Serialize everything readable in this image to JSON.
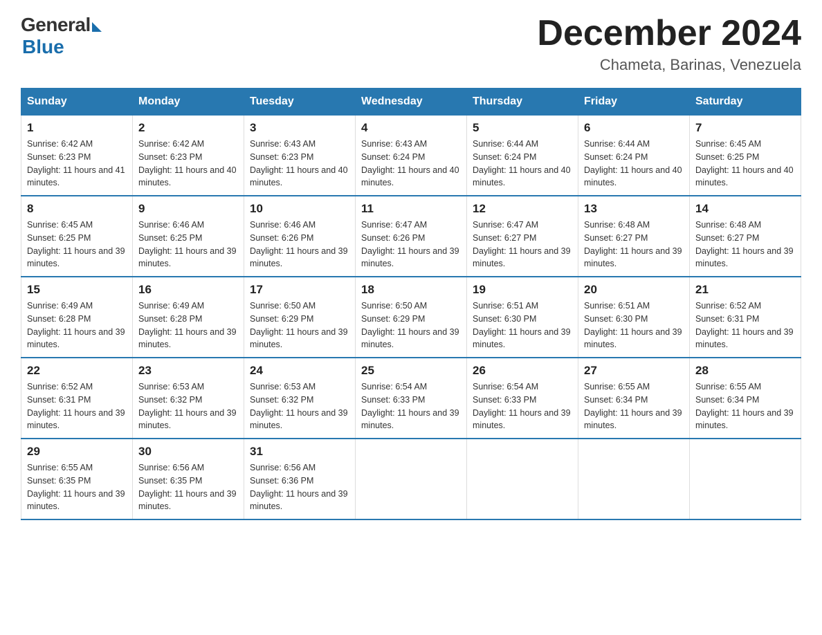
{
  "header": {
    "logo_general": "General",
    "logo_blue": "Blue",
    "month_title": "December 2024",
    "location": "Chameta, Barinas, Venezuela"
  },
  "days_of_week": [
    "Sunday",
    "Monday",
    "Tuesday",
    "Wednesday",
    "Thursday",
    "Friday",
    "Saturday"
  ],
  "weeks": [
    [
      {
        "day": "1",
        "sunrise": "6:42 AM",
        "sunset": "6:23 PM",
        "daylight": "11 hours and 41 minutes."
      },
      {
        "day": "2",
        "sunrise": "6:42 AM",
        "sunset": "6:23 PM",
        "daylight": "11 hours and 40 minutes."
      },
      {
        "day": "3",
        "sunrise": "6:43 AM",
        "sunset": "6:23 PM",
        "daylight": "11 hours and 40 minutes."
      },
      {
        "day": "4",
        "sunrise": "6:43 AM",
        "sunset": "6:24 PM",
        "daylight": "11 hours and 40 minutes."
      },
      {
        "day": "5",
        "sunrise": "6:44 AM",
        "sunset": "6:24 PM",
        "daylight": "11 hours and 40 minutes."
      },
      {
        "day": "6",
        "sunrise": "6:44 AM",
        "sunset": "6:24 PM",
        "daylight": "11 hours and 40 minutes."
      },
      {
        "day": "7",
        "sunrise": "6:45 AM",
        "sunset": "6:25 PM",
        "daylight": "11 hours and 40 minutes."
      }
    ],
    [
      {
        "day": "8",
        "sunrise": "6:45 AM",
        "sunset": "6:25 PM",
        "daylight": "11 hours and 39 minutes."
      },
      {
        "day": "9",
        "sunrise": "6:46 AM",
        "sunset": "6:25 PM",
        "daylight": "11 hours and 39 minutes."
      },
      {
        "day": "10",
        "sunrise": "6:46 AM",
        "sunset": "6:26 PM",
        "daylight": "11 hours and 39 minutes."
      },
      {
        "day": "11",
        "sunrise": "6:47 AM",
        "sunset": "6:26 PM",
        "daylight": "11 hours and 39 minutes."
      },
      {
        "day": "12",
        "sunrise": "6:47 AM",
        "sunset": "6:27 PM",
        "daylight": "11 hours and 39 minutes."
      },
      {
        "day": "13",
        "sunrise": "6:48 AM",
        "sunset": "6:27 PM",
        "daylight": "11 hours and 39 minutes."
      },
      {
        "day": "14",
        "sunrise": "6:48 AM",
        "sunset": "6:27 PM",
        "daylight": "11 hours and 39 minutes."
      }
    ],
    [
      {
        "day": "15",
        "sunrise": "6:49 AM",
        "sunset": "6:28 PM",
        "daylight": "11 hours and 39 minutes."
      },
      {
        "day": "16",
        "sunrise": "6:49 AM",
        "sunset": "6:28 PM",
        "daylight": "11 hours and 39 minutes."
      },
      {
        "day": "17",
        "sunrise": "6:50 AM",
        "sunset": "6:29 PM",
        "daylight": "11 hours and 39 minutes."
      },
      {
        "day": "18",
        "sunrise": "6:50 AM",
        "sunset": "6:29 PM",
        "daylight": "11 hours and 39 minutes."
      },
      {
        "day": "19",
        "sunrise": "6:51 AM",
        "sunset": "6:30 PM",
        "daylight": "11 hours and 39 minutes."
      },
      {
        "day": "20",
        "sunrise": "6:51 AM",
        "sunset": "6:30 PM",
        "daylight": "11 hours and 39 minutes."
      },
      {
        "day": "21",
        "sunrise": "6:52 AM",
        "sunset": "6:31 PM",
        "daylight": "11 hours and 39 minutes."
      }
    ],
    [
      {
        "day": "22",
        "sunrise": "6:52 AM",
        "sunset": "6:31 PM",
        "daylight": "11 hours and 39 minutes."
      },
      {
        "day": "23",
        "sunrise": "6:53 AM",
        "sunset": "6:32 PM",
        "daylight": "11 hours and 39 minutes."
      },
      {
        "day": "24",
        "sunrise": "6:53 AM",
        "sunset": "6:32 PM",
        "daylight": "11 hours and 39 minutes."
      },
      {
        "day": "25",
        "sunrise": "6:54 AM",
        "sunset": "6:33 PM",
        "daylight": "11 hours and 39 minutes."
      },
      {
        "day": "26",
        "sunrise": "6:54 AM",
        "sunset": "6:33 PM",
        "daylight": "11 hours and 39 minutes."
      },
      {
        "day": "27",
        "sunrise": "6:55 AM",
        "sunset": "6:34 PM",
        "daylight": "11 hours and 39 minutes."
      },
      {
        "day": "28",
        "sunrise": "6:55 AM",
        "sunset": "6:34 PM",
        "daylight": "11 hours and 39 minutes."
      }
    ],
    [
      {
        "day": "29",
        "sunrise": "6:55 AM",
        "sunset": "6:35 PM",
        "daylight": "11 hours and 39 minutes."
      },
      {
        "day": "30",
        "sunrise": "6:56 AM",
        "sunset": "6:35 PM",
        "daylight": "11 hours and 39 minutes."
      },
      {
        "day": "31",
        "sunrise": "6:56 AM",
        "sunset": "6:36 PM",
        "daylight": "11 hours and 39 minutes."
      },
      null,
      null,
      null,
      null
    ]
  ],
  "labels": {
    "sunrise_prefix": "Sunrise: ",
    "sunset_prefix": "Sunset: ",
    "daylight_prefix": "Daylight: "
  }
}
